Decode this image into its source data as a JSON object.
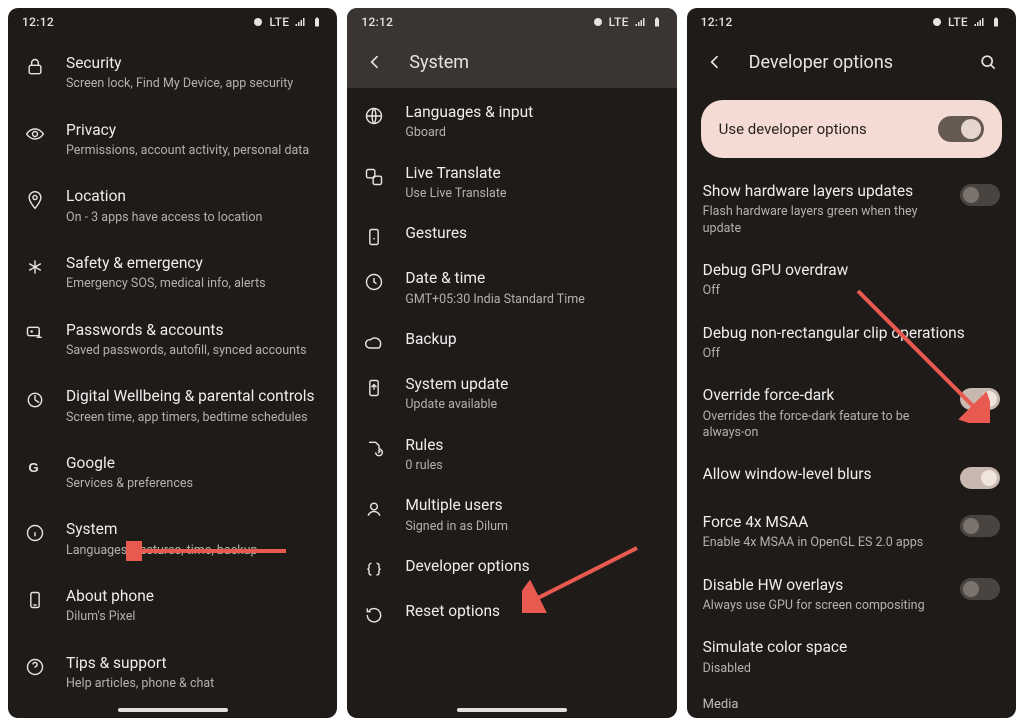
{
  "status": {
    "time": "12:12",
    "net": "LTE"
  },
  "screen1": {
    "items": [
      {
        "icon": "lock",
        "title": "Security",
        "sub": "Screen lock, Find My Device, app security"
      },
      {
        "icon": "eye",
        "title": "Privacy",
        "sub": "Permissions, account activity, personal data"
      },
      {
        "icon": "pin",
        "title": "Location",
        "sub": "On - 3 apps have access to location"
      },
      {
        "icon": "asterisk",
        "title": "Safety & emergency",
        "sub": "Emergency SOS, medical info, alerts"
      },
      {
        "icon": "key",
        "title": "Passwords & accounts",
        "sub": "Saved passwords, autofill, synced accounts"
      },
      {
        "icon": "wellbeing",
        "title": "Digital Wellbeing & parental controls",
        "sub": "Screen time, app timers, bedtime schedules"
      },
      {
        "icon": "google",
        "title": "Google",
        "sub": "Services & preferences"
      },
      {
        "icon": "info",
        "title": "System",
        "sub": "Languages, gestures, time, backup"
      },
      {
        "icon": "phone",
        "title": "About phone",
        "sub": "Dilum's Pixel"
      },
      {
        "icon": "help",
        "title": "Tips & support",
        "sub": "Help articles, phone & chat"
      }
    ]
  },
  "screen2": {
    "title": "System",
    "items": [
      {
        "icon": "globe",
        "title": "Languages & input",
        "sub": "Gboard"
      },
      {
        "icon": "translate",
        "title": "Live Translate",
        "sub": "Use Live Translate"
      },
      {
        "icon": "gesture",
        "title": "Gestures",
        "sub": ""
      },
      {
        "icon": "clock",
        "title": "Date & time",
        "sub": "GMT+05:30 India Standard Time"
      },
      {
        "icon": "cloud",
        "title": "Backup",
        "sub": ""
      },
      {
        "icon": "update",
        "title": "System update",
        "sub": "Update available"
      },
      {
        "icon": "rules",
        "title": "Rules",
        "sub": "0 rules"
      },
      {
        "icon": "user",
        "title": "Multiple users",
        "sub": "Signed in as Dilum"
      },
      {
        "icon": "braces",
        "title": "Developer options",
        "sub": ""
      },
      {
        "icon": "reset",
        "title": "Reset options",
        "sub": ""
      }
    ]
  },
  "screen3": {
    "title": "Developer options",
    "banner": "Use developer options",
    "items": [
      {
        "title": "Show hardware layers updates",
        "sub": "Flash hardware layers green when they update",
        "toggle": "off"
      },
      {
        "title": "Debug GPU overdraw",
        "sub": "Off"
      },
      {
        "title": "Debug non-rectangular clip operations",
        "sub": "Off"
      },
      {
        "title": "Override force-dark",
        "sub": "Overrides the force-dark feature to be always-on",
        "toggle": "on"
      },
      {
        "title": "Allow window-level blurs",
        "sub": "",
        "toggle": "on"
      },
      {
        "title": "Force 4x MSAA",
        "sub": "Enable 4x MSAA in OpenGL ES 2.0 apps",
        "toggle": "off"
      },
      {
        "title": "Disable HW overlays",
        "sub": "Always use GPU for screen compositing",
        "toggle": "off"
      },
      {
        "title": "Simulate color space",
        "sub": "Disabled"
      }
    ],
    "section": "Media"
  }
}
